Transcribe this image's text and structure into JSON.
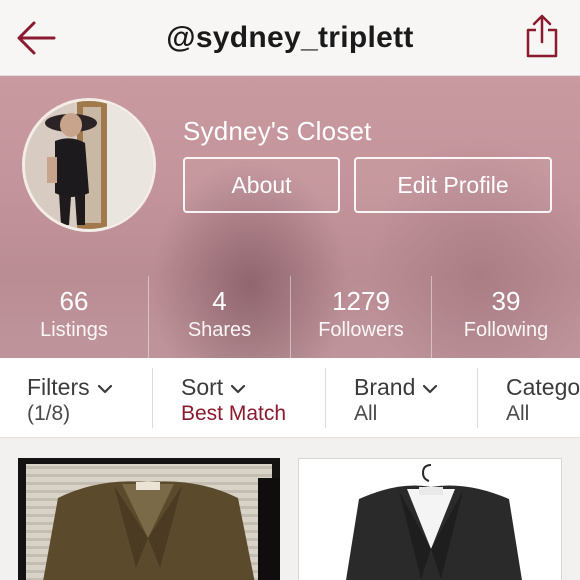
{
  "nav": {
    "username": "@sydney_triplett",
    "back_icon": "arrow-left-icon",
    "share_icon": "share-icon",
    "accent_color": "#8a1a2e"
  },
  "profile": {
    "closet_name": "Sydney's Closet",
    "about_label": "About",
    "edit_label": "Edit Profile",
    "stats": [
      {
        "value": "66",
        "label": "Listings"
      },
      {
        "value": "4",
        "label": "Shares"
      },
      {
        "value": "1279",
        "label": "Followers"
      },
      {
        "value": "39",
        "label": "Following"
      }
    ]
  },
  "filters": [
    {
      "title": "Filters",
      "value": "(1/8)"
    },
    {
      "title": "Sort",
      "value": "Best Match"
    },
    {
      "title": "Brand",
      "value": "All"
    },
    {
      "title": "Catego",
      "value": "All"
    }
  ]
}
